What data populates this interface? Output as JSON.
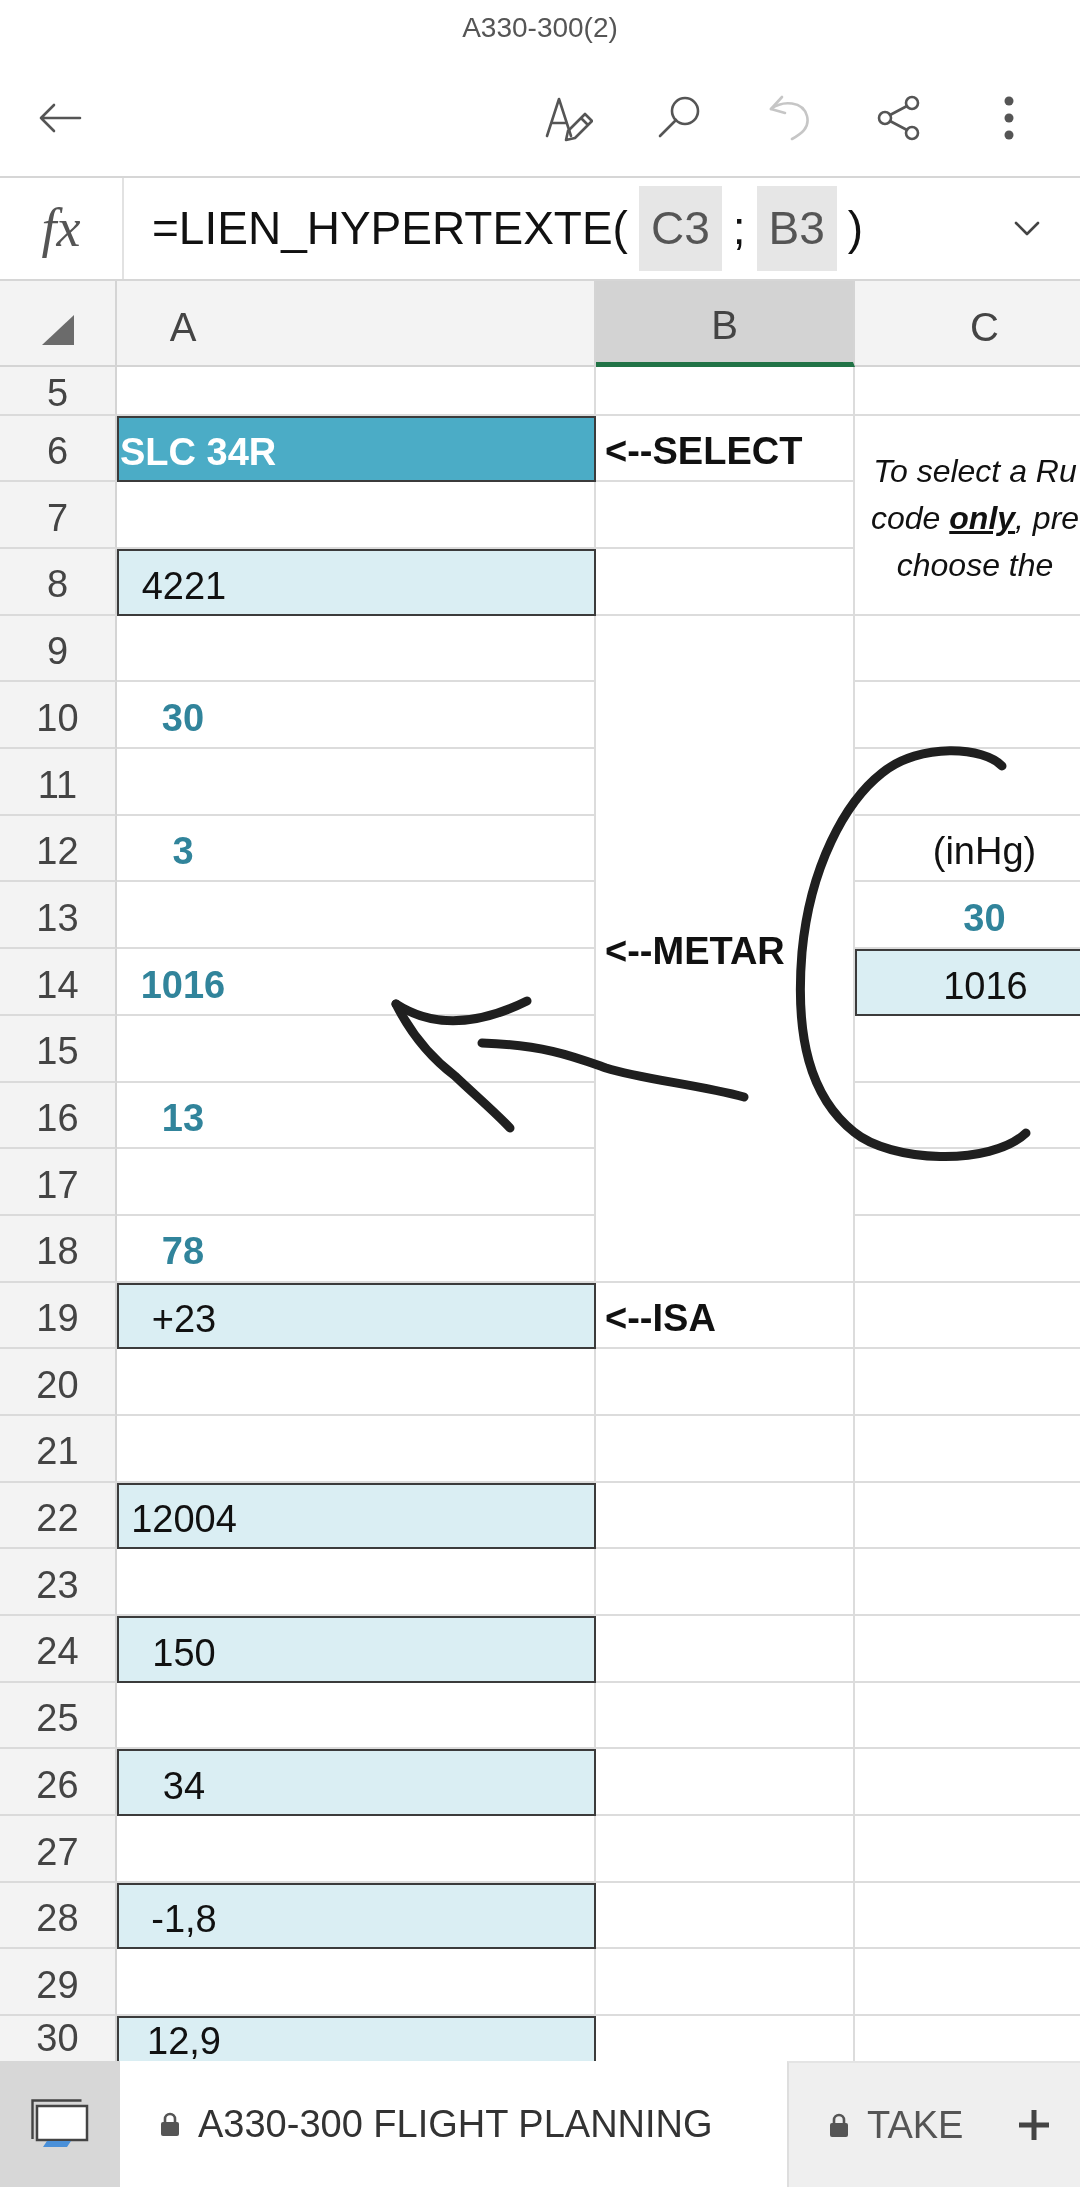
{
  "title": "A330-300(2)",
  "toolbar": [
    {
      "kind": "back",
      "disabled": false
    },
    {
      "kind": "edit",
      "disabled": false
    },
    {
      "kind": "search",
      "disabled": false
    },
    {
      "kind": "undo",
      "disabled": true
    },
    {
      "kind": "share",
      "disabled": false
    },
    {
      "kind": "more",
      "disabled": false
    }
  ],
  "formula_bar": {
    "label": "fx",
    "parts": [
      {
        "kind": "text",
        "text": "=LIEN_HYPERTEXTE("
      },
      {
        "kind": "reference",
        "text": "C3"
      },
      {
        "kind": "text",
        "text": ";"
      },
      {
        "kind": "reference",
        "text": "B3"
      },
      {
        "kind": "text",
        "text": ")"
      }
    ]
  },
  "columns": [
    {
      "label": "A",
      "selected": false
    },
    {
      "label": "B",
      "selected": true
    },
    {
      "label": "C",
      "selected": false
    }
  ],
  "rows": [
    {
      "number": "5"
    },
    {
      "number": "6",
      "a": {
        "kind": "selector",
        "text": "SLC 34R"
      },
      "b": {
        "kind": "label",
        "text": "<--SELECT"
      },
      "c": {
        "kind": "note",
        "lines": [
          "To select a Ru",
          "code **only**, pre",
          "choose the"
        ]
      }
    },
    {
      "number": "7",
      "c": {
        "kind": "continued"
      }
    },
    {
      "number": "8",
      "a": {
        "kind": "input",
        "text": "4221"
      },
      "c": {
        "kind": "continued"
      }
    },
    {
      "number": "9",
      "b": {
        "kind": "label",
        "text": "<--METAR"
      }
    },
    {
      "number": "10",
      "a": {
        "kind": "value",
        "text": "30"
      },
      "b": {
        "kind": "continued"
      }
    },
    {
      "number": "11",
      "b": {
        "kind": "continued"
      }
    },
    {
      "number": "12",
      "a": {
        "kind": "value",
        "text": "3"
      },
      "b": {
        "kind": "continued"
      },
      "c": {
        "kind": "unit",
        "text": "(inHg)"
      }
    },
    {
      "number": "13",
      "b": {
        "kind": "continued"
      },
      "c": {
        "kind": "value",
        "text": "30"
      }
    },
    {
      "number": "14",
      "a": {
        "kind": "value",
        "text": "1016"
      },
      "b": {
        "kind": "continued"
      },
      "c": {
        "kind": "input",
        "text": "1016"
      }
    },
    {
      "number": "15",
      "b": {
        "kind": "continued"
      }
    },
    {
      "number": "16",
      "a": {
        "kind": "value",
        "text": "13"
      },
      "b": {
        "kind": "continued"
      }
    },
    {
      "number": "17",
      "b": {
        "kind": "continued"
      }
    },
    {
      "number": "18",
      "a": {
        "kind": "value",
        "text": "78"
      },
      "b": {
        "kind": "continued"
      }
    },
    {
      "number": "19",
      "a": {
        "kind": "input",
        "text": "+23"
      },
      "b": {
        "kind": "label",
        "text": "<--ISA"
      }
    },
    {
      "number": "20"
    },
    {
      "number": "21"
    },
    {
      "number": "22",
      "a": {
        "kind": "input",
        "text": "12004"
      }
    },
    {
      "number": "23"
    },
    {
      "number": "24",
      "a": {
        "kind": "input",
        "text": "150"
      }
    },
    {
      "number": "25"
    },
    {
      "number": "26",
      "a": {
        "kind": "input",
        "text": "34"
      }
    },
    {
      "number": "27"
    },
    {
      "number": "28",
      "a": {
        "kind": "input",
        "text": "-1,8"
      }
    },
    {
      "number": "29"
    },
    {
      "number": "30",
      "a": {
        "kind": "input",
        "text": "12,9"
      }
    }
  ],
  "ink": [
    {
      "kind": "arrow"
    },
    {
      "kind": "curve"
    }
  ],
  "sheet_tabs": [
    {
      "label": "A330-300 FLIGHT PLANNING",
      "locked": true,
      "selected": true
    },
    {
      "label": "TAKE",
      "locked": true,
      "selected": false
    }
  ]
}
